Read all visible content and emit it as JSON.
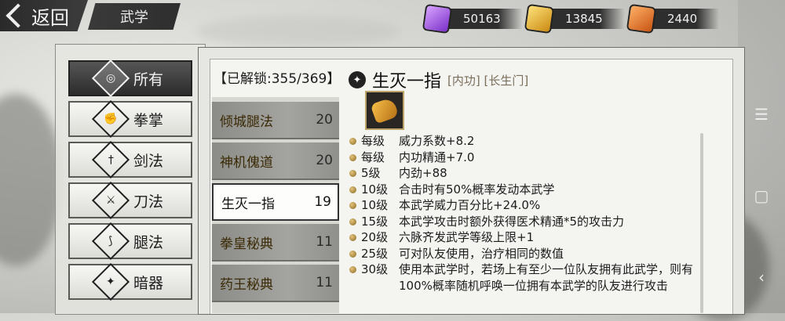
{
  "top": {
    "back_label": "返回",
    "screen_title": "武学",
    "currencies": [
      {
        "icon": "purple-token-icon",
        "value": "50163",
        "color": "#9b4ee0"
      },
      {
        "icon": "gold-token-icon",
        "value": "13845",
        "color": "#e0a52a"
      },
      {
        "icon": "orange-token-icon",
        "value": "2440",
        "color": "#e07a2a"
      }
    ]
  },
  "categories": [
    {
      "label": "所有",
      "icon": "all-icon",
      "active": true
    },
    {
      "label": "拳掌",
      "icon": "fist-icon",
      "active": false
    },
    {
      "label": "剑法",
      "icon": "sword-icon",
      "active": false
    },
    {
      "label": "刀法",
      "icon": "blade-icon",
      "active": false
    },
    {
      "label": "腿法",
      "icon": "leg-icon",
      "active": false
    },
    {
      "label": "暗器",
      "icon": "dart-icon",
      "active": false
    }
  ],
  "unlock": {
    "text": "【已解锁:355/369】"
  },
  "skills": [
    {
      "name": "倾城腿法",
      "level": "20"
    },
    {
      "name": "神机傀道",
      "level": "20"
    },
    {
      "name": "生灭一指",
      "level": "19"
    },
    {
      "name": "拳皇秘典",
      "level": "11"
    },
    {
      "name": "药王秘典",
      "level": "11"
    }
  ],
  "detail": {
    "name": "生灭一指",
    "tags": "[内功] [长生门]",
    "effects": [
      {
        "level": "每级",
        "text": "威力系数+8.2"
      },
      {
        "level": "每级",
        "text": "内功精通+7.0"
      },
      {
        "level": "5级",
        "text": "内劲+88"
      },
      {
        "level": "10级",
        "text": "合击时有50%概率发动本武学"
      },
      {
        "level": "10级",
        "text": "本武学威力百分比+24.0%"
      },
      {
        "level": "15级",
        "text": "本武学攻击时额外获得医术精通*5的攻击力"
      },
      {
        "level": "20级",
        "text": "六脉齐发武学等级上限+1"
      },
      {
        "level": "25级",
        "text": "可对队友使用，治疗相同的数值"
      },
      {
        "level": "30级",
        "text": "使用本武学时，若场上有至少一位队友拥有此武学，则有100%概率随机呼唤一位拥有本武学的队友进行攻击"
      }
    ]
  }
}
